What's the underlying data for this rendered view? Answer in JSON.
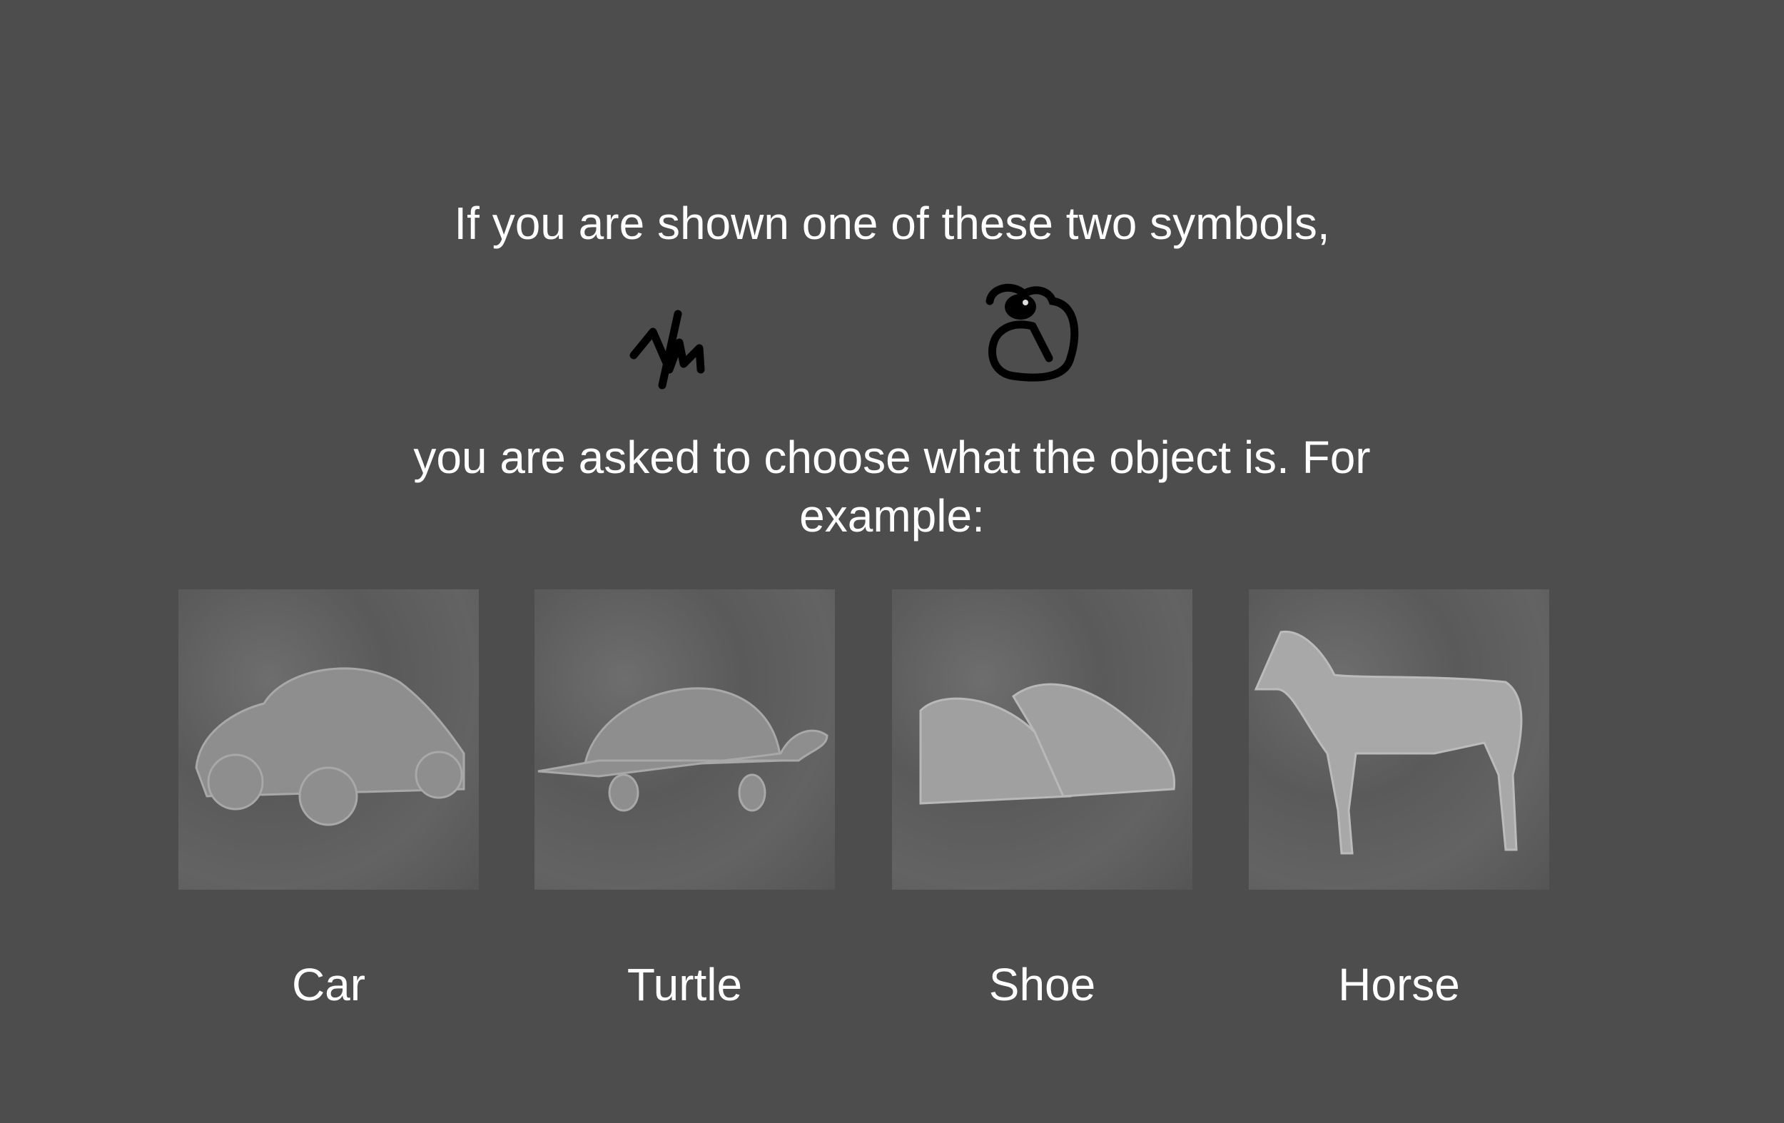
{
  "instructions": {
    "line1": "If you are shown one of these two symbols,",
    "line2": "you are asked to choose what the object is. For example:"
  },
  "symbols": [
    {
      "icon": "zigzag-symbol-icon"
    },
    {
      "icon": "loop-symbol-icon"
    }
  ],
  "options": [
    {
      "label": "Car"
    },
    {
      "label": "Turtle"
    },
    {
      "label": "Shoe"
    },
    {
      "label": "Horse"
    }
  ],
  "colors": {
    "background": "#4d4d4d",
    "text": "#ffffff"
  }
}
